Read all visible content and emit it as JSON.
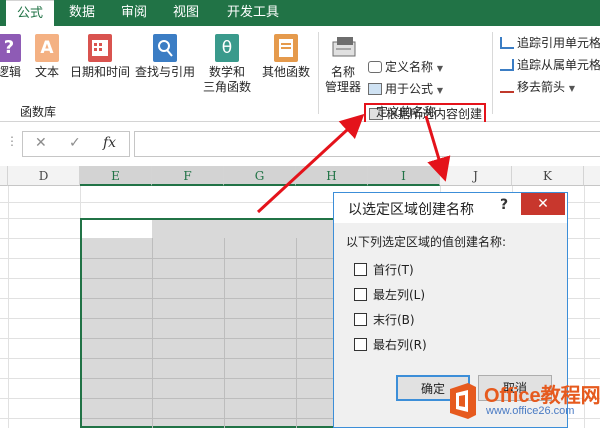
{
  "tabs": [
    "公式",
    "数据",
    "审阅",
    "视图",
    "开发工具"
  ],
  "ribbon": {
    "function_library": {
      "buttons": [
        {
          "label": "逻辑",
          "icon": "logic-icon"
        },
        {
          "label": "文本",
          "icon": "text-icon"
        },
        {
          "label": "日期和时间",
          "icon": "datetime-icon"
        },
        {
          "label": "查找与引用",
          "icon": "lookup-icon"
        },
        {
          "label": "数学和\n三角函数",
          "icon": "math-icon"
        },
        {
          "label": "其他函数",
          "icon": "more-functions-icon"
        }
      ],
      "group_label": "函数库"
    },
    "defined_names": {
      "name_manager": "名称\n管理器",
      "define_name": "定义名称",
      "use_in_formula": "用于公式",
      "create_from_selection": "根据所选内容创建",
      "group_label": "定义的名称"
    },
    "formula_auditing": {
      "trace_precedents": "追踪引用单元格",
      "trace_dependents": "追踪从属单元格",
      "remove_arrows": "移去箭头"
    }
  },
  "formula_bar": {
    "cancel": "✕",
    "enter": "✓",
    "fx": "fx",
    "value": ""
  },
  "columns": [
    "D",
    "E",
    "F",
    "G",
    "H",
    "I",
    "J",
    "K"
  ],
  "selected_columns": [
    "E",
    "F",
    "G",
    "H",
    "I"
  ],
  "dialog": {
    "title": "以选定区域创建名称",
    "help": "?",
    "close": "✕",
    "prompt": "以下列选定区域的值创建名称:",
    "options": [
      {
        "label": "首行(T)",
        "checked": false
      },
      {
        "label": "最左列(L)",
        "checked": false
      },
      {
        "label": "末行(B)",
        "checked": false
      },
      {
        "label": "最右列(R)",
        "checked": false
      }
    ],
    "ok": "确定",
    "cancel": "取消"
  },
  "watermark": {
    "brand": "Office教程网",
    "url": "www.office26.com"
  },
  "colors": {
    "accent": "#217346",
    "highlight": "#e4131b",
    "dialog_border": "#3c8ed8",
    "close_button": "#c8372d"
  }
}
